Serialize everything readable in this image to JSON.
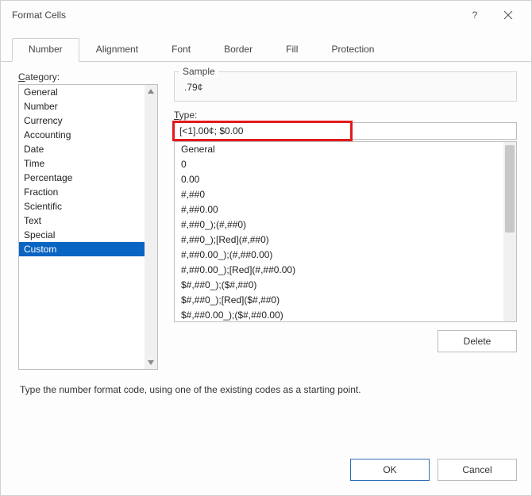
{
  "window": {
    "title": "Format Cells"
  },
  "tabs": [
    "Number",
    "Alignment",
    "Font",
    "Border",
    "Fill",
    "Protection"
  ],
  "active_tab_index": 0,
  "category": {
    "label": "Category:",
    "items": [
      "General",
      "Number",
      "Currency",
      "Accounting",
      "Date",
      "Time",
      "Percentage",
      "Fraction",
      "Scientific",
      "Text",
      "Special",
      "Custom"
    ],
    "selected_index": 11
  },
  "sample": {
    "label": "Sample",
    "value": ".79¢"
  },
  "type_field": {
    "label": "Type:",
    "value": "[<1].00¢; $0.00"
  },
  "format_list": [
    "General",
    "0",
    "0.00",
    "#,##0",
    "#,##0.00",
    "#,##0_);(#,##0)",
    "#,##0_);[Red](#,##0)",
    "#,##0.00_);(#,##0.00)",
    "#,##0.00_);[Red](#,##0.00)",
    "$#,##0_);($#,##0)",
    "$#,##0_);[Red]($#,##0)",
    "$#,##0.00_);($#,##0.00)"
  ],
  "buttons": {
    "delete": "Delete",
    "ok": "OK",
    "cancel": "Cancel"
  },
  "hint": "Type the number format code, using one of the existing codes as a starting point."
}
